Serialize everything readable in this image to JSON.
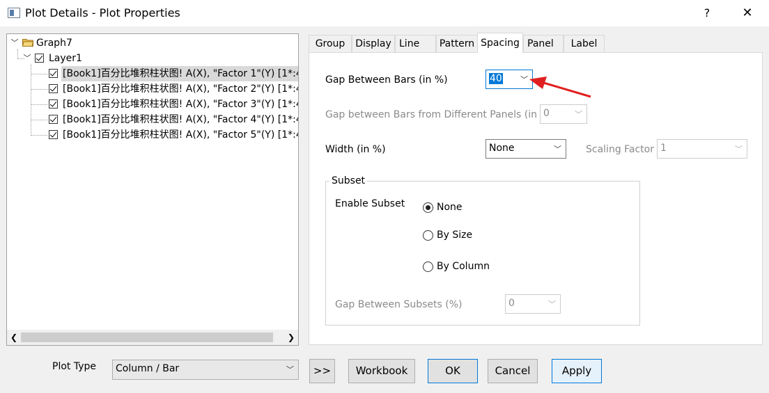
{
  "window": {
    "title": "Plot Details - Plot Properties",
    "help_label": "?",
    "close_label": "✕"
  },
  "tree": {
    "root": "Graph7",
    "layer": "Layer1",
    "items": [
      "[Book1]百分比堆积柱状图! A(X), \"Factor 1\"(Y) [1*:4",
      "[Book1]百分比堆积柱状图! A(X), \"Factor 2\"(Y) [1*:4",
      "[Book1]百分比堆积柱状图! A(X), \"Factor 3\"(Y) [1*:4",
      "[Book1]百分比堆积柱状图! A(X), \"Factor 4\"(Y) [1*:4",
      "[Book1]百分比堆积柱状图! A(X), \"Factor 5\"(Y) [1*:4"
    ]
  },
  "tabs": [
    "Group",
    "Display",
    "Line",
    "Pattern",
    "Spacing",
    "Panel",
    "Label"
  ],
  "active_tab": "Spacing",
  "spacing": {
    "gap_between_bars_label": "Gap Between Bars (in %)",
    "gap_between_bars_value": "40",
    "gap_panels_label": "Gap between Bars from Different Panels (in %)",
    "gap_panels_value": "0",
    "width_label": "Width (in %)",
    "width_value": "None",
    "scaling_factor_label": "Scaling Factor",
    "scaling_factor_value": "1",
    "subset_title": "Subset",
    "enable_subset_label": "Enable Subset",
    "options": [
      "None",
      "By Size",
      "By Column"
    ],
    "selected_option": "None",
    "gap_subsets_label": "Gap Between Subsets (%)",
    "gap_subsets_value": "0"
  },
  "bottom": {
    "plot_type_label": "Plot Type",
    "plot_type_value": "Column / Bar",
    "expand_label": ">>",
    "workbook_label": "Workbook",
    "ok_label": "OK",
    "cancel_label": "Cancel",
    "apply_label": "Apply"
  },
  "colors": {
    "accent": "#0078d7",
    "annotation_arrow": "#e02020",
    "folder": "#e8b84a"
  }
}
